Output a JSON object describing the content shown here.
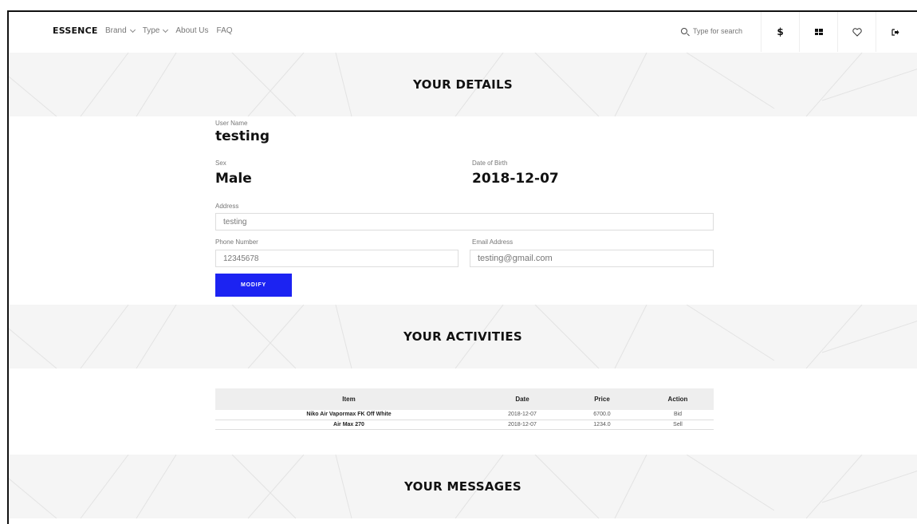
{
  "nav": {
    "brand": "ESSENCE",
    "menu": [
      {
        "label": "Brand",
        "dropdown": true
      },
      {
        "label": "Type",
        "dropdown": true
      },
      {
        "label": "About Us",
        "dropdown": false
      },
      {
        "label": "FAQ",
        "dropdown": false
      }
    ],
    "search_placeholder": "Type for search",
    "currency_symbol": "$",
    "icons": [
      "search-icon",
      "dollar-icon",
      "grid-icon",
      "heart-icon",
      "logout-icon"
    ]
  },
  "details": {
    "heading": "YOUR DETAILS",
    "username_label": "User Name",
    "username": "testing",
    "sex_label": "Sex",
    "sex": "Male",
    "dob_label": "Date of Birth",
    "dob": "2018-12-07",
    "address_label": "Address",
    "address": "testing",
    "phone_label": "Phone Number",
    "phone": "12345678",
    "email_label": "Email Address",
    "email": "testing@gmail.com",
    "modify_label": "MODIFY"
  },
  "activities": {
    "heading": "YOUR ACTIVITIES",
    "columns": [
      "Item",
      "Date",
      "Price",
      "Action"
    ],
    "rows": [
      {
        "item": "Niko Air Vapormax FK Off White",
        "date": "2018-12-07",
        "price": "6700.0",
        "action": "Bid"
      },
      {
        "item": "Air Max 270",
        "date": "2018-12-07",
        "price": "1234.0",
        "action": "Sell"
      }
    ]
  },
  "messages": {
    "heading": "YOUR MESSAGES"
  },
  "colors": {
    "accent": "#1c23f2",
    "banner_bg": "#f5f5f5",
    "text": "#111111"
  }
}
